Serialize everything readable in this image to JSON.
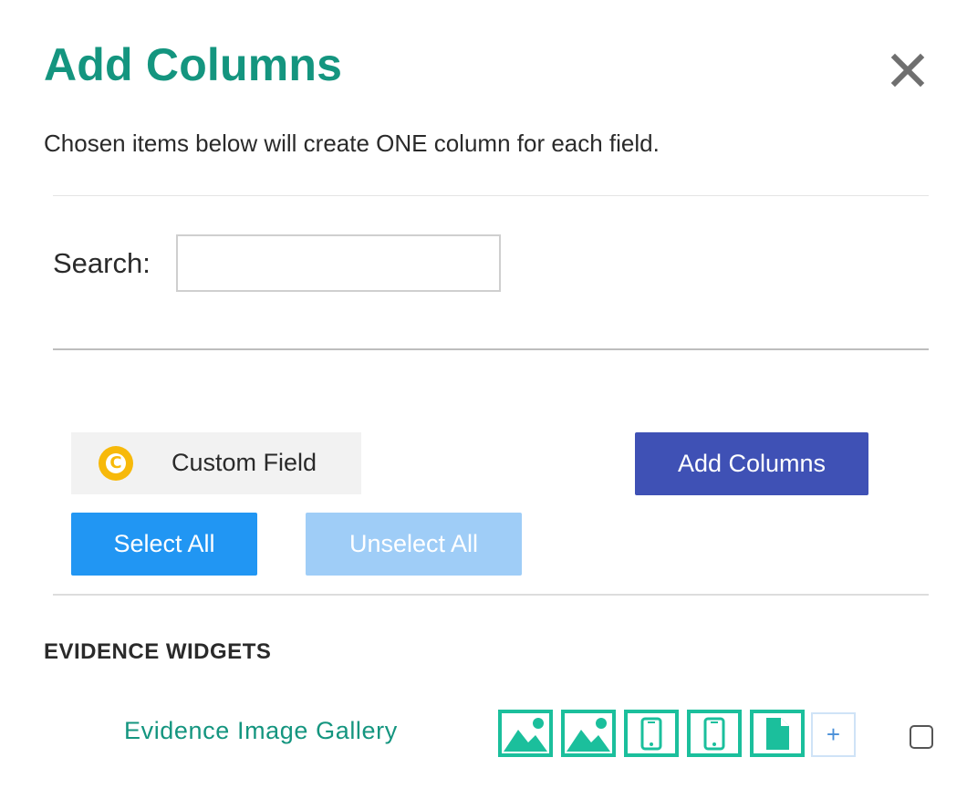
{
  "dialog": {
    "title": "Add Columns",
    "subtitle": "Chosen items below will create ONE column for each field.",
    "close_icon": "close-icon"
  },
  "search": {
    "label": "Search:",
    "value": "",
    "placeholder": ""
  },
  "custom_field": {
    "badge_letter": "C",
    "label": "Custom Field",
    "badge_color": "#f7b90a"
  },
  "actions": {
    "add_columns_label": "Add Columns",
    "select_all_label": "Select All",
    "unselect_all_label": "Unselect All"
  },
  "section": {
    "heading": "EVIDENCE WIDGETS",
    "rows": [
      {
        "label": "Evidence Image Gallery",
        "icons": [
          "image-icon",
          "image-icon",
          "mobile-icon",
          "mobile-icon",
          "document-icon",
          "plus-icon"
        ],
        "plus_symbol": "+",
        "checked": false
      }
    ]
  },
  "colors": {
    "title": "#14957f",
    "primary_button": "#3f51b5",
    "select_button": "#2196f3",
    "unselect_button": "#9fcdf7",
    "icon_teal": "#1bbf9c"
  }
}
